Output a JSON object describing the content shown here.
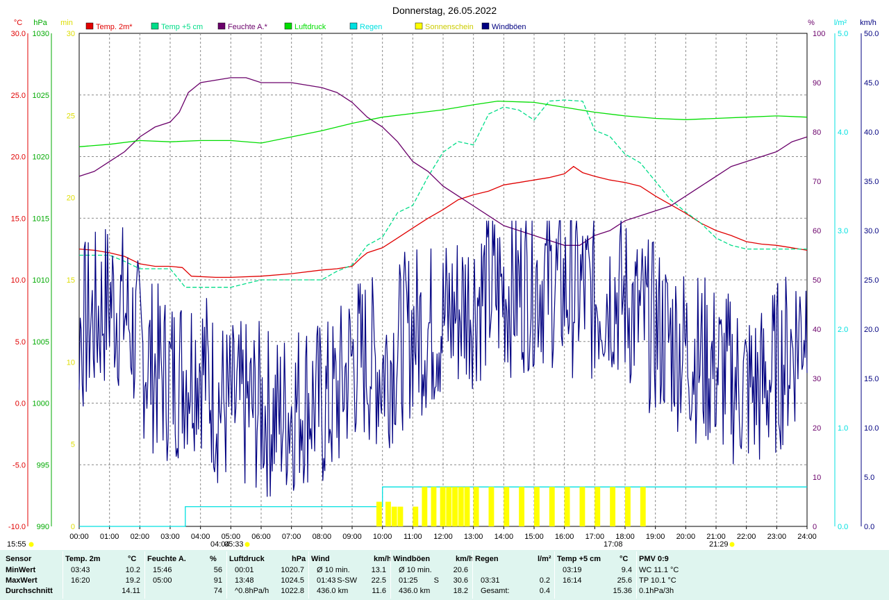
{
  "title": "Donnerstag, 26.05.2022",
  "colors": {
    "temp2m": "#e00000",
    "temp5cm": "#00dd88",
    "humidity": "#6a006a",
    "pressure": "#00dd00",
    "rain": "#00e0e0",
    "sunshine": "#ffff00",
    "gusts": "#000080",
    "grid": "#888888",
    "stats_bg": "#dff5ef"
  },
  "axes": {
    "left_units": [
      "°C",
      "hPa",
      "min"
    ],
    "right_units": [
      "%",
      "l/m²",
      "km/h"
    ],
    "temp_ticks": [
      "30.0",
      "25.0",
      "20.0",
      "15.0",
      "10.0",
      "5.0",
      "0.0",
      "-5.0",
      "-10.0"
    ],
    "pressure_ticks": [
      "1030",
      "1025",
      "1020",
      "1015",
      "1010",
      "1005",
      "1000",
      "995",
      "990"
    ],
    "minutes_ticks": [
      "30",
      "25",
      "20",
      "15",
      "10",
      "5",
      "0"
    ],
    "humidity_ticks": [
      "100",
      "90",
      "80",
      "70",
      "60",
      "50",
      "40",
      "30",
      "20",
      "10",
      "0"
    ],
    "rain_ticks": [
      "5.0",
      "4.0",
      "3.0",
      "2.0",
      "1.0",
      "0.0"
    ],
    "wind_ticks": [
      "50.0",
      "45.0",
      "40.0",
      "35.0",
      "30.0",
      "25.0",
      "20.0",
      "15.0",
      "10.0",
      "5.0",
      "0.0"
    ],
    "x_ticks": [
      "00:00",
      "01:00",
      "02:00",
      "03:00",
      "04:00",
      "05:00",
      "06:00",
      "07:00",
      "08:00",
      "09:00",
      "10:00",
      "11:00",
      "12:00",
      "13:00",
      "14:00",
      "15:00",
      "16:00",
      "17:00",
      "18:00",
      "19:00",
      "20:00",
      "21:00",
      "22:00",
      "23:00",
      "24:00"
    ]
  },
  "markers": {
    "sunrise_left": "15:55",
    "sunrise_time1": "04:04",
    "sunrise_time2": "05:33",
    "mark_17": "17:08",
    "sunset": "21:29"
  },
  "chart_data": {
    "type": "line",
    "xlim": [
      0,
      24
    ],
    "x_unit": "hours",
    "legend": [
      "Temp. 2m*",
      "Temp +5 cm",
      "Feuchte A.*",
      "Luftdruck",
      "Regen",
      "Sonnenschein",
      "Windböen"
    ],
    "legend_placement": "top",
    "grid": true,
    "series": [
      {
        "name": "Temp. 2m*",
        "axis": "°C",
        "ylim": [
          -10,
          30
        ],
        "x": [
          0,
          0.5,
          1,
          1.5,
          2,
          2.5,
          3,
          3.4,
          3.7,
          4.5,
          5,
          6,
          7,
          8,
          8.5,
          9,
          9.3,
          9.5,
          10,
          10.5,
          11,
          11.5,
          12,
          12.5,
          13,
          13.5,
          14,
          14.5,
          15,
          15.5,
          16,
          16.3,
          16.6,
          17,
          17.5,
          18,
          18.5,
          19,
          19.5,
          20,
          20.5,
          21,
          21.5,
          22,
          22.5,
          23,
          23.5,
          24
        ],
        "y": [
          12.5,
          12.4,
          12.2,
          11.9,
          11.3,
          11.1,
          11.1,
          11.0,
          10.3,
          10.2,
          10.2,
          10.3,
          10.5,
          10.8,
          10.9,
          11.1,
          11.8,
          12.2,
          12.6,
          13.4,
          14.2,
          15.0,
          15.7,
          16.5,
          16.9,
          17.2,
          17.7,
          17.9,
          18.1,
          18.3,
          18.6,
          19.2,
          18.7,
          18.4,
          18.1,
          17.9,
          17.6,
          16.8,
          16.1,
          15.4,
          14.6,
          14.0,
          13.6,
          13.1,
          12.9,
          12.8,
          12.6,
          12.4
        ]
      },
      {
        "name": "Temp +5 cm",
        "axis": "°C",
        "ylim": [
          -10,
          30
        ],
        "x": [
          0,
          1,
          1.5,
          2,
          3,
          3.5,
          4,
          5,
          6,
          7,
          8,
          8.5,
          9,
          9.5,
          10,
          10.5,
          11,
          11.5,
          12,
          12.5,
          13,
          13.5,
          14,
          14.5,
          15,
          15.5,
          16,
          16.3,
          16.6,
          17,
          17.5,
          18,
          18.5,
          19,
          19.5,
          20,
          20.5,
          21,
          21.5,
          22,
          22.5,
          23,
          23.5,
          24
        ],
        "y": [
          12.0,
          12.0,
          11.5,
          10.9,
          10.9,
          9.4,
          9.4,
          9.4,
          10.0,
          10.0,
          10.0,
          10.7,
          11.2,
          12.8,
          13.5,
          15.3,
          17.0,
          19.0,
          20.5,
          21.2,
          22.0,
          22.5,
          23.8,
          24.0,
          23.5,
          23.8,
          24.2,
          25.6,
          24.5,
          22.8,
          21.2,
          20.2,
          19.5,
          18.0,
          16.5,
          15.5,
          14.6,
          13.4,
          12.8,
          12.5,
          12.5,
          12.5,
          12.5,
          12.5
        ]
      },
      {
        "name": "Feuchte A.*",
        "axis": "%",
        "ylim": [
          0,
          100
        ],
        "x": [
          0,
          0.5,
          1,
          1.5,
          2,
          2.5,
          3,
          3.3,
          3.6,
          4,
          5,
          5.5,
          6,
          7,
          8,
          8.5,
          9,
          9.5,
          10,
          10.5,
          11,
          11.5,
          12,
          12.5,
          13,
          13.5,
          14,
          14.5,
          15,
          15.5,
          16,
          16.5,
          17,
          17.5,
          18,
          18.5,
          19,
          19.5,
          20,
          20.5,
          21,
          21.5,
          22,
          22.5,
          23,
          23.5,
          24
        ],
        "y": [
          71,
          72,
          74,
          76,
          79,
          81,
          82,
          84,
          88,
          90,
          91,
          91,
          90,
          90,
          89,
          88,
          86,
          83,
          81,
          78,
          74,
          72,
          69,
          67,
          65,
          63,
          61,
          60,
          59,
          58,
          57,
          57,
          59,
          60,
          62,
          63,
          64,
          65,
          67,
          69,
          71,
          73,
          74,
          75,
          76,
          78,
          79
        ]
      },
      {
        "name": "Luftdruck",
        "axis": "hPa",
        "ylim": [
          990,
          1030
        ],
        "x": [
          0,
          1,
          2,
          3,
          4,
          5,
          6,
          7,
          8,
          9,
          10,
          11,
          12,
          13,
          13.8,
          15,
          16,
          17,
          18,
          19,
          20,
          21,
          22,
          23,
          24
        ],
        "y": [
          1020.8,
          1021.0,
          1021.3,
          1021.2,
          1021.3,
          1021.3,
          1021.1,
          1021.6,
          1022.1,
          1022.7,
          1023.2,
          1023.5,
          1023.8,
          1024.2,
          1024.5,
          1024.4,
          1024.0,
          1023.6,
          1023.3,
          1023.1,
          1023.0,
          1023.1,
          1023.2,
          1023.3,
          1023.2
        ]
      },
      {
        "name": "Regen",
        "axis": "l/m²",
        "ylim": [
          0,
          5.0
        ],
        "x": [
          0,
          3.5,
          3.5,
          10,
          10,
          24
        ],
        "y": [
          0,
          0,
          0.2,
          0.2,
          0.4,
          0.4
        ]
      },
      {
        "name": "Sonnenschein",
        "axis": "min",
        "ylim": [
          0,
          30
        ],
        "x": [
          9.8,
          10.1,
          10.3,
          10.5,
          11.0,
          11.3,
          11.6,
          11.9,
          12.1,
          12.3,
          12.5,
          12.7,
          13.0,
          13.5,
          14.0,
          14.5,
          15.0,
          15.5,
          16.0,
          16.5,
          17.0,
          17.5,
          18.0,
          18.5
        ],
        "y": [
          1,
          1,
          0.8,
          0.8,
          0.8,
          1.6,
          1.6,
          1.6,
          1.6,
          1.6,
          1.6,
          1.6,
          1.6,
          1.6,
          1.6,
          1.6,
          1.6,
          1.6,
          1.6,
          1.6,
          1.6,
          1.6,
          1.6,
          1.6
        ]
      },
      {
        "name": "Windböen",
        "axis": "km/h",
        "ylim": [
          0,
          50
        ],
        "x": [
          0,
          0.5,
          1,
          1.5,
          2,
          2.5,
          3,
          3.5,
          4,
          4.5,
          5,
          5.5,
          6,
          6.5,
          7,
          7.5,
          8,
          8.5,
          9,
          9.5,
          10,
          10.5,
          11,
          11.5,
          12,
          12.5,
          13,
          13.5,
          14,
          14.5,
          15,
          15.5,
          16,
          16.5,
          17,
          17.5,
          18,
          18.5,
          19,
          19.5,
          20,
          20.5,
          21,
          21.5,
          22,
          22.5,
          23,
          23.5,
          24
        ],
        "y": [
          20,
          21,
          23,
          22,
          18,
          16,
          15,
          16,
          17,
          13,
          12,
          12,
          12,
          11,
          12,
          13,
          12,
          13,
          17,
          17,
          16,
          18,
          20,
          20,
          21,
          22,
          23,
          24,
          24,
          24,
          25,
          25,
          24,
          24,
          23,
          24,
          23,
          21,
          20,
          19,
          18,
          17,
          16,
          15,
          14,
          14,
          16,
          18,
          22
        ]
      }
    ],
    "gust_spikes": {
      "x": [
        1.43,
        16.0,
        8.0,
        14.1
      ],
      "y": [
        30.6,
        30.0,
        4.8,
        31.1
      ]
    }
  },
  "stats": {
    "headers": [
      {
        "label": "Sensor",
        "unit": ""
      },
      {
        "label": "Temp. 2m",
        "unit": "°C"
      },
      {
        "label": "Feuchte A.",
        "unit": "%"
      },
      {
        "label": "Luftdruck",
        "unit": "hPa"
      },
      {
        "label": "Wind",
        "unit": "km/h"
      },
      {
        "label": "Windböen",
        "unit": "km/h"
      },
      {
        "label": "Regen",
        "unit": "l/m²"
      },
      {
        "label": "Temp +5 cm",
        "unit": "°C"
      },
      {
        "label": "PMV 0:9",
        "unit": ""
      }
    ],
    "rows": [
      {
        "label": "MinWert",
        "temp2m": [
          "03:43",
          "10.2"
        ],
        "hum": [
          "15:46",
          "56"
        ],
        "press": [
          "00:01",
          "1020.7"
        ],
        "wind": [
          "Ø 10 min.",
          "",
          "13.1"
        ],
        "gust": [
          "Ø 10 min.",
          "",
          "20.6"
        ],
        "rain": [
          "",
          ""
        ],
        "temp5": [
          "03:19",
          "9.4"
        ],
        "pmv": "WC 11.1 °C"
      },
      {
        "label": "MaxWert",
        "temp2m": [
          "16:20",
          "19.2"
        ],
        "hum": [
          "05:00",
          "91"
        ],
        "press": [
          "13:48",
          "1024.5"
        ],
        "wind": [
          "01:43",
          "S-SW",
          "22.5"
        ],
        "gust": [
          "01:25",
          "S",
          "30.6"
        ],
        "rain": [
          "03:31",
          "0.2"
        ],
        "temp5": [
          "16:14",
          "25.6"
        ],
        "pmv": "TP 10.1 °C"
      },
      {
        "label": "Durchschnitt",
        "temp2m": [
          "",
          "14.11"
        ],
        "hum": [
          "",
          "74"
        ],
        "press": [
          "^0.8hPa/h",
          "1022.8"
        ],
        "wind": [
          "436.0 km",
          "",
          "11.6"
        ],
        "gust": [
          "436.0 km",
          "",
          "18.2"
        ],
        "rain": [
          "Gesamt:",
          "0.4"
        ],
        "temp5": [
          "",
          "15.36"
        ],
        "pmv": "0.1hPa/3h"
      }
    ]
  }
}
